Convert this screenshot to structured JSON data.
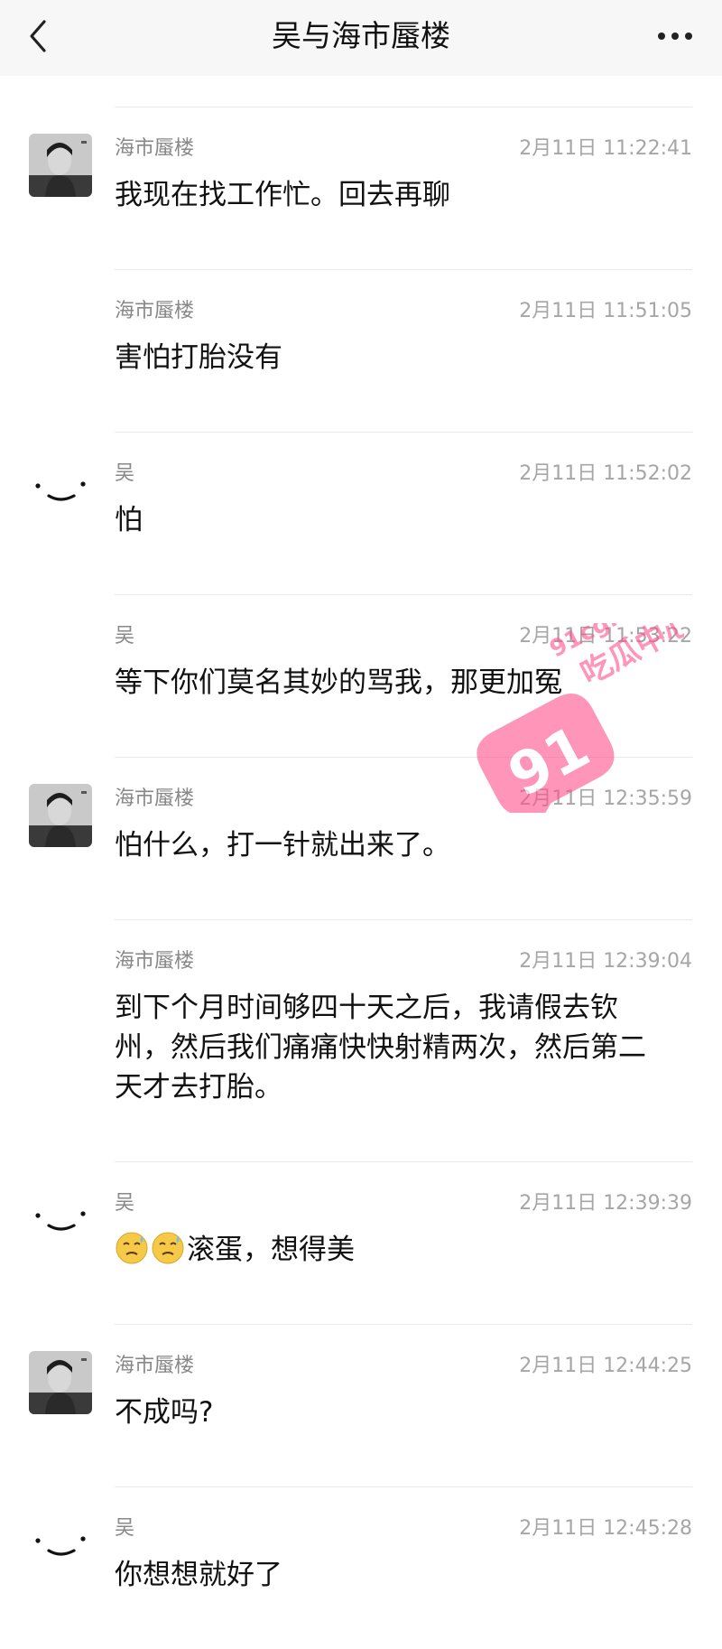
{
  "header": {
    "title": "吴与海市蜃楼",
    "back_icon": "chevron-left-icon",
    "more_icon": "ellipsis-icon"
  },
  "messages": [
    {
      "sender": "海市蜃楼",
      "time": "2月11日 11:22:41",
      "text": "我现在找工作忙。回去再聊",
      "avatar": "photo"
    },
    {
      "sender": "海市蜃楼",
      "time": "2月11日 11:51:05",
      "text": "害怕打胎没有",
      "avatar": ""
    },
    {
      "sender": "吴",
      "time": "2月11日 11:52:02",
      "text": "怕",
      "avatar": "smile"
    },
    {
      "sender": "吴",
      "time": "2月11日 11:53:22",
      "text": "等下你们莫名其妙的骂我，那更加冤",
      "avatar": ""
    },
    {
      "sender": "海市蜃楼",
      "time": "2月11日 12:35:59",
      "text": "怕什么，打一针就出来了。",
      "avatar": "photo"
    },
    {
      "sender": "海市蜃楼",
      "time": "2月11日 12:39:04",
      "text": "到下个月时间够四十天之后，我请假去钦州，然后我们痛痛快快射精两次，然后第二天才去打胎。",
      "avatar": ""
    },
    {
      "sender": "吴",
      "time": "2月11日 12:39:39",
      "text": "滚蛋，想得美",
      "avatar": "smile",
      "emoji_count": 2
    },
    {
      "sender": "海市蜃楼",
      "time": "2月11日 12:44:25",
      "text": "不成吗?",
      "avatar": "photo"
    },
    {
      "sender": "吴",
      "time": "2月11日 12:45:28",
      "text": "你想想就好了",
      "avatar": "smile"
    }
  ],
  "watermark": {
    "domain": "91cg.dev",
    "name": "吃瓜中心",
    "number": "91",
    "color": "#ff4f8b"
  }
}
